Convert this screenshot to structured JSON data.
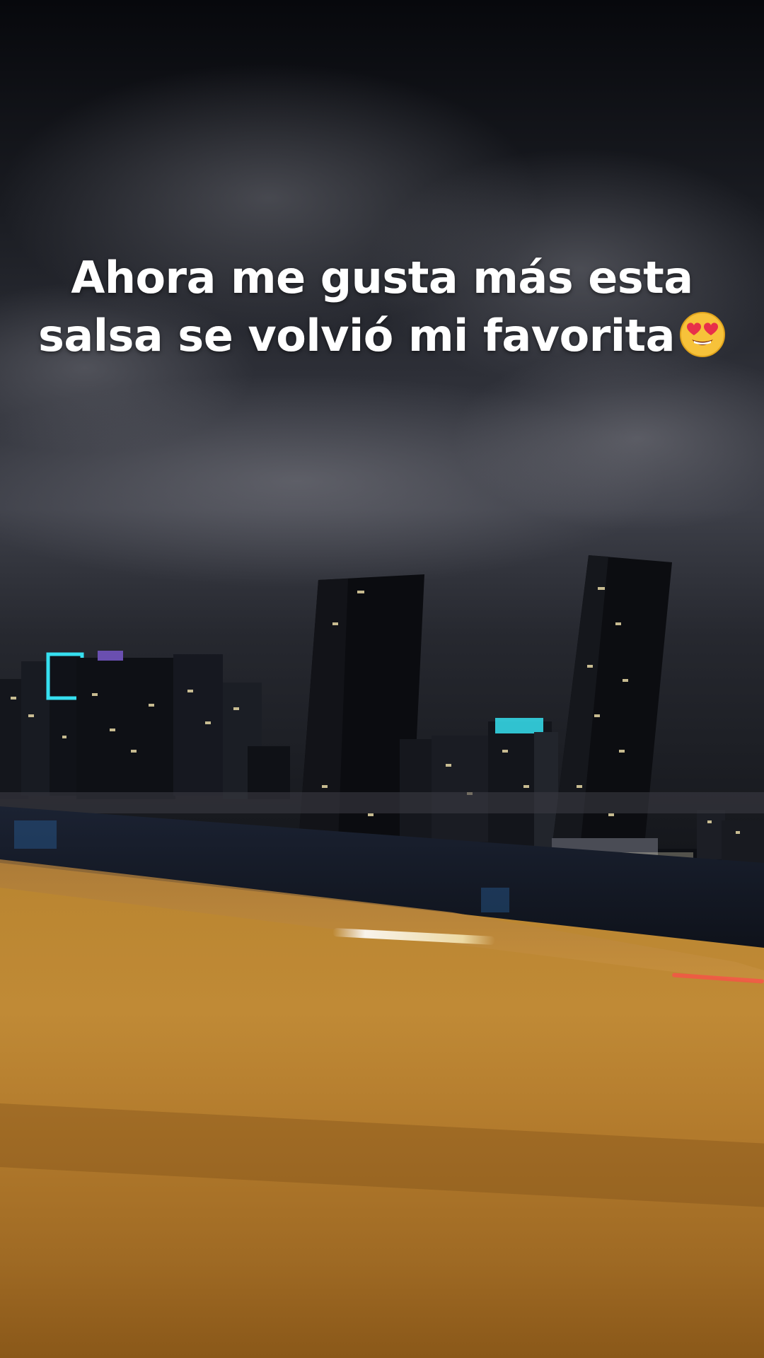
{
  "caption": {
    "line1": "Ahora me gusta más esta",
    "line2": "salsa se volvió mi favorita",
    "emoji": "smiling-face-with-heart-eyes"
  },
  "colors": {
    "sky_top": "#0a0c11",
    "sky_mid": "#3a3c45",
    "water": "#141a26",
    "wall_light": "#c68b35",
    "wall_dark": "#8c5a1c",
    "tower_glow": "#36e0f0"
  }
}
